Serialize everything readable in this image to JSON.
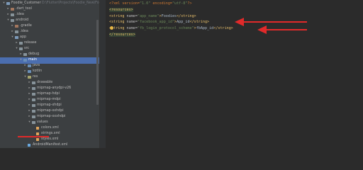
{
  "project_tree": {
    "rows": [
      {
        "label": "Foodie_Customer",
        "path": "D:\\Flutter\\Projects\\Foodie_New\\Foodie_Customer",
        "icon": "module-icon",
        "expanded": true
      },
      {
        "label": ".dart_tool",
        "icon": "folder-excluded-icon",
        "expanded": false
      },
      {
        "label": ".idea",
        "icon": "folder-icon",
        "expanded": false
      },
      {
        "label": "android",
        "icon": "folder-icon",
        "expanded": true
      },
      {
        "label": ".gradle",
        "icon": "folder-excluded-icon",
        "expanded": false
      },
      {
        "label": ".idea",
        "icon": "folder-icon",
        "expanded": false
      },
      {
        "label": "app",
        "icon": "module-icon",
        "expanded": true
      },
      {
        "label": "release",
        "icon": "folder-icon",
        "expanded": false
      },
      {
        "label": "src",
        "icon": "folder-icon",
        "expanded": true
      },
      {
        "label": "debug",
        "icon": "folder-icon",
        "expanded": false
      },
      {
        "label": "main",
        "icon": "folder-source-icon",
        "expanded": true,
        "selected": true
      },
      {
        "label": "java",
        "icon": "folder-source-icon",
        "expanded": false
      },
      {
        "label": "kotlin",
        "icon": "folder-source-icon",
        "expanded": false
      },
      {
        "label": "res",
        "icon": "folder-resource-icon",
        "expanded": true
      },
      {
        "label": "drawable",
        "icon": "folder-icon",
        "expanded": false
      },
      {
        "label": "mipmap-anydpi-v26",
        "icon": "folder-icon",
        "expanded": false
      },
      {
        "label": "mipmap-hdpi",
        "icon": "folder-icon",
        "expanded": false
      },
      {
        "label": "mipmap-mdpi",
        "icon": "folder-icon",
        "expanded": false
      },
      {
        "label": "mipmap-xhdpi",
        "icon": "folder-icon",
        "expanded": false
      },
      {
        "label": "mipmap-xxhdpi",
        "icon": "folder-icon",
        "expanded": false
      },
      {
        "label": "mipmap-xxxhdpi",
        "icon": "folder-icon",
        "expanded": false
      },
      {
        "label": "values",
        "icon": "folder-icon",
        "expanded": true
      },
      {
        "label": "colors.xml",
        "icon": "xml-file-icon"
      },
      {
        "label": "strings.xml",
        "icon": "xml-file-icon"
      },
      {
        "label": "styles.xml",
        "icon": "xml-file-icon"
      },
      {
        "label": "AndroidManifest.xml",
        "icon": "manifest-file-icon"
      },
      {
        "label": "build.gradle",
        "icon": "gradle-file-icon"
      }
    ]
  },
  "editor": {
    "lines": [
      {
        "parts": [
          {
            "t": "<?xml version=",
            "c": "pi"
          },
          {
            "t": "\"1.0\"",
            "c": "str"
          },
          {
            "t": " encoding=",
            "c": "pi"
          },
          {
            "t": "\"utf-8\"",
            "c": "str"
          },
          {
            "t": "?>",
            "c": "pi"
          }
        ]
      },
      {
        "parts": [
          {
            "t": "<resources>",
            "c": "tag"
          }
        ],
        "highlight": true
      },
      {
        "parts": [
          {
            "t": "    <string ",
            "c": "tag"
          },
          {
            "t": "name=",
            "c": "attr"
          },
          {
            "t": "\"app_name\"",
            "c": "str"
          },
          {
            "t": ">",
            "c": "tag"
          },
          {
            "t": "Foodies",
            "c": "gray"
          },
          {
            "t": "</string>",
            "c": "tag"
          }
        ]
      },
      {
        "parts": [
          {
            "t": "    <string ",
            "c": "tag"
          },
          {
            "t": "name=",
            "c": "attr"
          },
          {
            "t": "\"facebook_app_id\"",
            "c": "str"
          },
          {
            "t": ">",
            "c": "tag"
          },
          {
            "t": "App_id",
            "c": "gray"
          },
          {
            "t": "</string>",
            "c": "tag"
          }
        ]
      },
      {
        "parts": [
          {
            "t": "    <string ",
            "c": "tag"
          },
          {
            "t": "name=",
            "c": "attr"
          },
          {
            "t": "\"fb_login_protocol_scheme\"",
            "c": "str"
          },
          {
            "t": ">",
            "c": "tag"
          },
          {
            "t": "fbApp_id",
            "c": "gray"
          },
          {
            "t": "</string>",
            "c": "tag"
          }
        ]
      },
      {
        "parts": [
          {
            "t": "</resources>",
            "c": "tag"
          }
        ],
        "highlight": true
      }
    ]
  },
  "annotations": {
    "color": "#e12a2a",
    "arrows": [
      "facebook_app_id line",
      "fb_login_protocol_scheme line"
    ],
    "underline_target": "strings.xml"
  }
}
